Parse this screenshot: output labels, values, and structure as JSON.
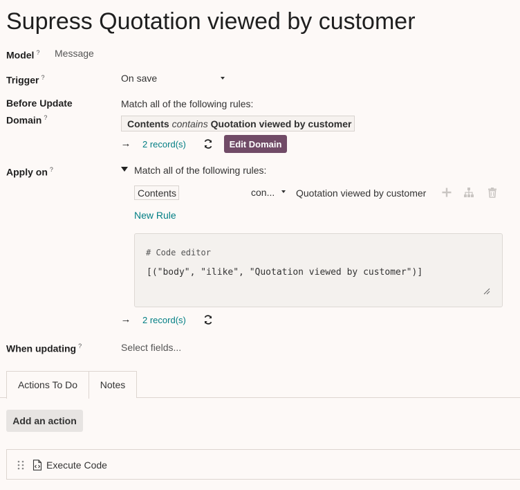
{
  "record": {
    "title": "Supress Quotation viewed by customer"
  },
  "fields": {
    "model": {
      "label": "Model",
      "help": "?",
      "value": "Message"
    },
    "trigger": {
      "label": "Trigger",
      "help": "?",
      "value": "On save"
    },
    "before_update": {
      "label_line1": "Before Update",
      "label_line2": "Domain",
      "help": "?",
      "match_text": "Match all of the following rules:",
      "rule_field": "Contents",
      "rule_operator": "contains",
      "rule_value": "Quotation viewed by customer",
      "records_link": "2 record(s)",
      "edit_button": "Edit Domain"
    },
    "apply_on": {
      "label": "Apply on",
      "help": "?",
      "match_text": "Match all of the following rules:",
      "rule_field": "Contents",
      "rule_operator": "con...",
      "rule_value": "Quotation viewed by customer",
      "new_rule": "New Rule",
      "code_comment": "# Code editor",
      "code": "[(\"body\", \"ilike\", \"Quotation viewed by customer\")]",
      "records_link": "2 record(s)"
    },
    "when_updating": {
      "label": "When updating",
      "help": "?",
      "placeholder": "Select fields..."
    }
  },
  "tabs": [
    {
      "label": "Actions To Do",
      "active": true
    },
    {
      "label": "Notes",
      "active": false
    }
  ],
  "actions": {
    "add_button": "Add an action",
    "items": [
      {
        "label": "Execute Code",
        "icon": "code-file-icon"
      }
    ]
  },
  "colors": {
    "primary": "#714b67",
    "link": "#017e84",
    "background": "#fdf9f7"
  }
}
